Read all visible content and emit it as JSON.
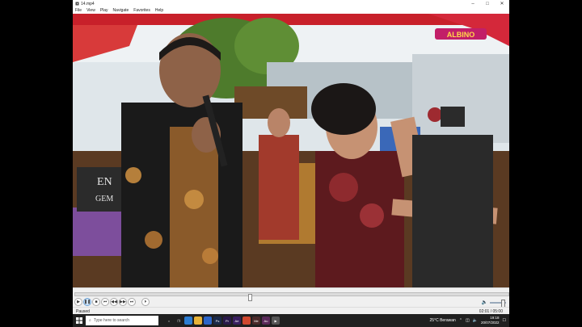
{
  "window": {
    "title": "14.mp4",
    "controls": {
      "minimize": "–",
      "maximize": "□",
      "close": "✕"
    }
  },
  "menu": [
    "File",
    "View",
    "Play",
    "Navigate",
    "Favorites",
    "Help"
  ],
  "video": {
    "logo_text": "ALBINO",
    "banner_text": "EN",
    "banner_text2": "GEM"
  },
  "player": {
    "position_fraction": 0.4,
    "volume_fraction": 0.7,
    "buttons": [
      "play-icon",
      "pause-icon",
      "stop-icon",
      "prev-icon",
      "rewind-icon",
      "forward-icon",
      "next-icon",
      "frame-step-icon"
    ],
    "status": "Paused",
    "time": "02:01 / 05:00"
  },
  "taskbar": {
    "search_placeholder": "Type here to search",
    "weather": "25°C  Berawan",
    "time": "19:18",
    "date": "20/07/2022",
    "colors": {
      "bg": "#202020"
    }
  }
}
